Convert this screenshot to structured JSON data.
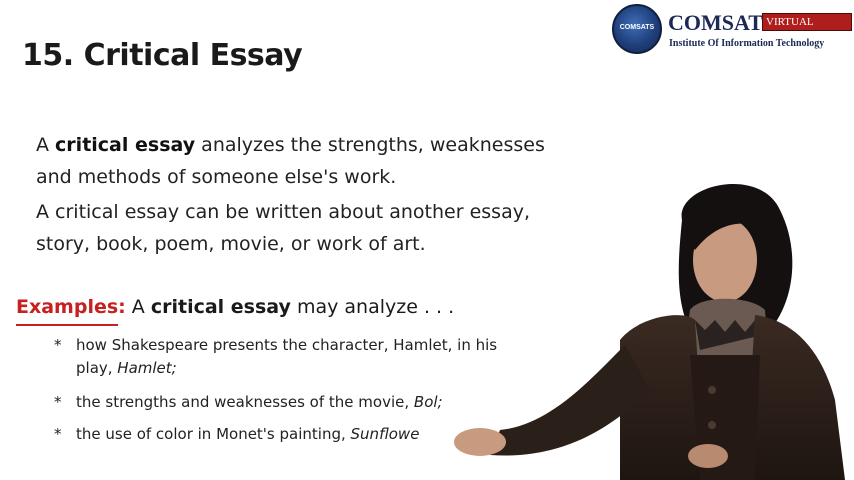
{
  "slide": {
    "number": "15.",
    "title": "Critical Essay"
  },
  "logo": {
    "seal_text": "COMSATS",
    "brand": "COMSATS",
    "tag": "VIRTUAL CAMPUS",
    "institute": "Institute Of Information Technology"
  },
  "paragraphs": [
    {
      "pre": "A ",
      "bold": "critical essay",
      "post": " analyzes the strengths, weaknesses and methods of someone else's work."
    },
    {
      "text": "A critical essay can be written about another essay, story, book, poem, movie, or work of art."
    }
  ],
  "examples": {
    "label": "Examples:",
    "pre": " A ",
    "bold": "critical essay",
    "post": " may analyze . . .",
    "bullets": [
      {
        "text": "how Shakespeare presents the character, Hamlet, in his play, ",
        "italic": "Hamlet;"
      },
      {
        "text": "the strengths and weaknesses of the movie, ",
        "italic": "Bol;"
      },
      {
        "text": "the use of color in Monet's painting, ",
        "italic": "Sunflowe"
      }
    ],
    "bullet_marker": "*"
  },
  "colors": {
    "accent_red": "#c62020",
    "brand_blue": "#1b2a55",
    "tag_red": "#b01d1d"
  }
}
